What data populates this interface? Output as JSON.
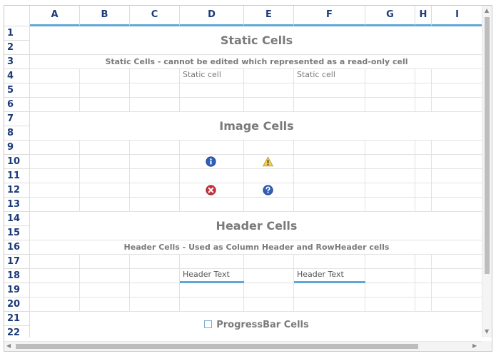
{
  "columns": [
    "A",
    "B",
    "C",
    "D",
    "E",
    "F",
    "G",
    "H",
    "I"
  ],
  "rows": [
    "1",
    "2",
    "3",
    "4",
    "5",
    "6",
    "7",
    "8",
    "9",
    "10",
    "11",
    "12",
    "13",
    "14",
    "15",
    "16",
    "17",
    "18",
    "19",
    "20",
    "21",
    "22"
  ],
  "sections": {
    "static_title": "Static Cells",
    "static_desc": "Static Cells - cannot be edited which represented as a read-only cell",
    "static_cell_d4": "Static cell",
    "static_cell_f4": "Static cell",
    "image_title": "Image Cells",
    "header_title": "Header Cells",
    "header_desc": "Header Cells - Used as Column Header and RowHeader cells",
    "header_text_d18": "Header Text",
    "header_text_f18": "Header Text",
    "progress_title": "ProgressBar Cells"
  },
  "icons": {
    "d10": "info-icon",
    "e10": "warning-icon",
    "d12": "error-icon",
    "e12": "question-icon"
  },
  "colors": {
    "header_accent": "#5ea8d8",
    "header_text": "#1a3a78",
    "title_text": "#7a7a7a"
  }
}
